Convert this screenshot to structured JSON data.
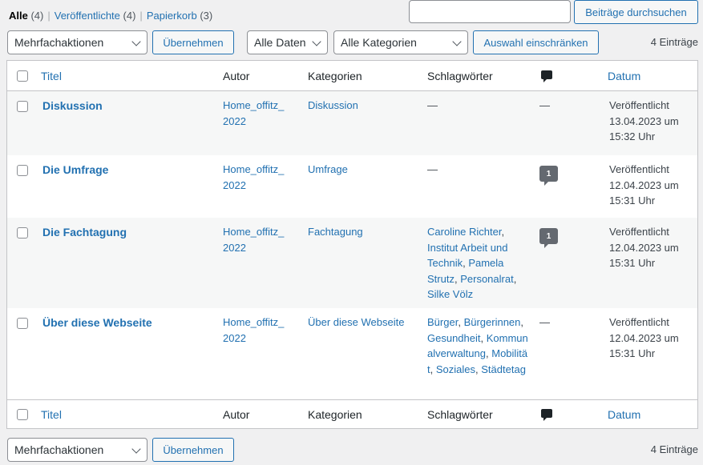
{
  "filters": {
    "all_label": "Alle",
    "all_count": "(4)",
    "published_label": "Veröffentlichte",
    "published_count": "(4)",
    "trash_label": "Papierkorb",
    "trash_count": "(3)",
    "separator": "|"
  },
  "search": {
    "placeholder": "",
    "value": "",
    "button_label": "Beiträge durchsuchen"
  },
  "toolbar_top": {
    "bulk_actions": "Mehrfachaktionen",
    "apply": "Übernehmen",
    "dates": "Alle Daten",
    "categories": "Alle Kategorien",
    "filter_button": "Auswahl einschränken",
    "items_count": "4 Einträge"
  },
  "columns": {
    "title": "Titel",
    "author": "Autor",
    "categories": "Kategorien",
    "tags": "Schlagwörter",
    "comments_icon": "comment-bubble-icon",
    "date": "Datum"
  },
  "rows": [
    {
      "title": "Diskussion",
      "author_line1": "Home_offitz_",
      "author_line2": "2022",
      "category": "Diskussion",
      "tags": [],
      "tags_empty": "—",
      "comments": "—",
      "status": "Veröffentlicht",
      "date": "13.04.2023 um",
      "time": "15:32 Uhr"
    },
    {
      "title": "Die Umfrage",
      "author_line1": "Home_offitz_",
      "author_line2": "2022",
      "category": "Umfrage",
      "tags": [],
      "tags_empty": "—",
      "comments": "1",
      "status": "Veröffentlicht",
      "date": "12.04.2023 um",
      "time": "15:31 Uhr"
    },
    {
      "title": "Die Fachtagung",
      "author_line1": "Home_offitz_",
      "author_line2": "2022",
      "category": "Fachtagung",
      "tags": [
        "Caroline Richter",
        "Institut Arbeit und Technik",
        "Pamela Strutz",
        "Personalrat",
        "Silke Völz"
      ],
      "comments": "1",
      "status": "Veröffentlicht",
      "date": "12.04.2023 um",
      "time": "15:31 Uhr"
    },
    {
      "title": "Über diese Webseite",
      "author_line1": "Home_offitz_",
      "author_line2": "2022",
      "category": "Über diese Webseite",
      "tags": [
        "Bürger",
        "Bürgerinnen",
        "Gesundheit",
        "Kommunalverwaltung",
        "Mobilität",
        "Soziales",
        "Städtetag"
      ],
      "comments": "—",
      "status": "Veröffentlicht",
      "date": "12.04.2023 um",
      "time": "15:31 Uhr"
    }
  ],
  "toolbar_bottom": {
    "bulk_actions": "Mehrfachaktionen",
    "apply": "Übernehmen",
    "items_count": "4 Einträge"
  },
  "colors": {
    "link": "#2271b1",
    "badge": "#646970",
    "alt_row": "#f6f7f7",
    "border": "#c3c4c7"
  }
}
